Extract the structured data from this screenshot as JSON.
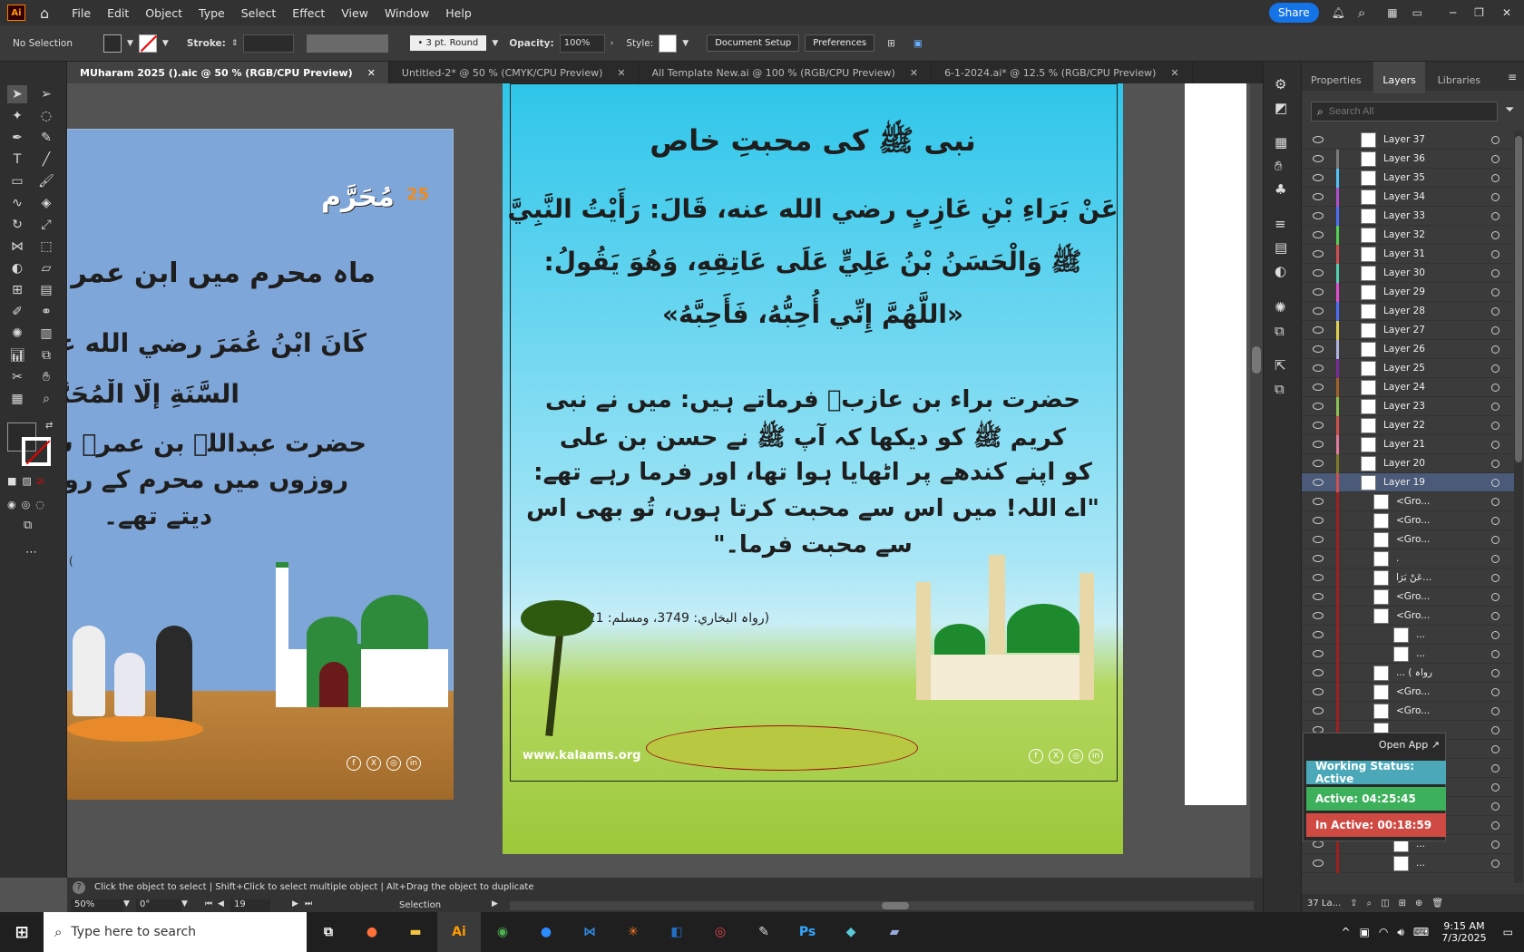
{
  "app": {
    "logo": "Ai",
    "menu": [
      "File",
      "Edit",
      "Object",
      "Type",
      "Select",
      "Effect",
      "View",
      "Window",
      "Help"
    ],
    "share": "Share"
  },
  "control": {
    "selection": "No Selection",
    "stroke_label": "Stroke:",
    "brush": "3 pt. Round",
    "opacity_label": "Opacity:",
    "opacity": "100%",
    "style_label": "Style:",
    "doc_setup": "Document Setup",
    "preferences": "Preferences"
  },
  "tabs": [
    {
      "label": "MUharam 2025 ().aic @ 50 % (RGB/CPU Preview)"
    },
    {
      "label": "Untitled-2* @ 50 % (CMYK/CPU Preview)"
    },
    {
      "label": "All Template New.ai @ 100 % (RGB/CPU Preview)"
    },
    {
      "label": "6-1-2024.ai* @ 12.5 % (RGB/CPU Preview)"
    }
  ],
  "left_art": {
    "logo_text": "مُحَرَّم",
    "logo_num": "25",
    "headline": "ماہ محرم میں ابن عمر",
    "arabic1": "كَانَ ابْنُ عُمَرَ رضي الله عنهما",
    "arabic2": "السَّنَةِ إِلَّا الْمُحَرَّ",
    "urdu1": "حضرت عبداللہ بن عمرؓ سا",
    "urdu2": "روزوں میں محرم کے روز",
    "urdu3": "دیتے تھے۔",
    "paren": "(",
    "social": [
      "f",
      "X",
      "◎",
      "in"
    ]
  },
  "main_art": {
    "title": "نبی ﷺ کی محبتِ خاص",
    "arabic": [
      "عَنْ بَرَاءِ بْنِ عَازِبٍ رضي الله عنه، قَالَ: رَأَيْتُ النَّبِيَّ",
      "ﷺ وَالْحَسَنُ بْنُ عَلِيٍّ عَلَى عَاتِقِهِ، وَهُوَ يَقُولُ:",
      "«اللَّهُمَّ إِنِّي أُحِبُّهُ، فَأَحِبَّهُ»"
    ],
    "urdu": [
      "حضرت براء بن عازبؓ فرماتے ہیں: میں نے نبی",
      "کریم ﷺ کو دیکھا کہ آپ ﷺ نے حسن بن علی",
      "کو اپنے کندھے پر اٹھایا ہوا تھا، اور فرما رہے تھے:",
      "\"اے اللہ! میں اس سے محبت کرتا ہوں، تُو بھی اس",
      "سے محبت فرما۔\""
    ],
    "reference": "(رواہ البخاري: 3749، ومسلم: 2421 )",
    "website": "www.kalaams.org",
    "social": [
      "f",
      "X",
      "◎",
      "in"
    ]
  },
  "status": {
    "hint": "Click the object to select  |  Shift+Click to select multiple object  |  Alt+Drag the object to duplicate",
    "zoom": "50%",
    "rotation": "0°",
    "artboard": "19",
    "tool": "Selection"
  },
  "panel": {
    "tabs": [
      "Properties",
      "Layers",
      "Libraries"
    ],
    "search_placeholder": "Search All",
    "layers": [
      {
        "name": "Layer 37",
        "color": "#3c3c3c"
      },
      {
        "name": "Layer 36",
        "color": "#7a7a7a"
      },
      {
        "name": "Layer 35",
        "color": "#4fc3f7"
      },
      {
        "name": "Layer 34",
        "color": "#b04fd0"
      },
      {
        "name": "Layer 33",
        "color": "#4f6ef7"
      },
      {
        "name": "Layer 32",
        "color": "#4fd04f"
      },
      {
        "name": "Layer 31",
        "color": "#d04f4f"
      },
      {
        "name": "Layer 30",
        "color": "#4fd0b0"
      },
      {
        "name": "Layer 29",
        "color": "#e04fd0"
      },
      {
        "name": "Layer 28",
        "color": "#4f6ef7"
      },
      {
        "name": "Layer 27",
        "color": "#e0d04f"
      },
      {
        "name": "Layer 26",
        "color": "#b0b0e0"
      },
      {
        "name": "Layer 25",
        "color": "#7a2a9a"
      },
      {
        "name": "Layer 24",
        "color": "#a0602a"
      },
      {
        "name": "Layer 23",
        "color": "#8ac04f"
      },
      {
        "name": "Layer 22",
        "color": "#d04f4f"
      },
      {
        "name": "Layer 21",
        "color": "#e07a9a"
      },
      {
        "name": "Layer 20",
        "color": "#7a7a2a"
      },
      {
        "name": "Layer 19",
        "color": "#d04f4f",
        "selected": true
      },
      {
        "name": "<Gro...",
        "color": "#a01f1f",
        "sub": true
      },
      {
        "name": "<Gro...",
        "color": "#a01f1f",
        "sub": true
      },
      {
        "name": "<Gro...",
        "color": "#a01f1f",
        "sub": true
      },
      {
        "name": ".",
        "color": "#a01f1f",
        "sub": true
      },
      {
        "name": "عَنْ بَرَا...",
        "color": "#a01f1f",
        "sub": true
      },
      {
        "name": "<Gro...",
        "color": "#a01f1f",
        "sub": true
      },
      {
        "name": "<Gro...",
        "color": "#a01f1f",
        "sub": true
      },
      {
        "name": "...",
        "color": "#a01f1f",
        "sub": true,
        "deep": true
      },
      {
        "name": "...",
        "color": "#a01f1f",
        "sub": true,
        "deep": true
      },
      {
        "name": "... ( رواہ",
        "color": "#a01f1f",
        "sub": true
      },
      {
        "name": "<Gro...",
        "color": "#a01f1f",
        "sub": true
      },
      {
        "name": "<Gro...",
        "color": "#a01f1f",
        "sub": true
      },
      {
        "name": "",
        "color": "#a01f1f",
        "sub": true
      },
      {
        "name": "",
        "color": "#a01f1f",
        "sub": true
      },
      {
        "name": "",
        "color": "#a01f1f",
        "sub": true
      },
      {
        "name": "",
        "color": "#a01f1f",
        "sub": true
      },
      {
        "name": "",
        "color": "#a01f1f",
        "sub": true
      },
      {
        "name": "...",
        "color": "#a01f1f",
        "sub": true,
        "deep": true
      },
      {
        "name": "...",
        "color": "#a01f1f",
        "sub": true,
        "deep": true
      },
      {
        "name": "...",
        "color": "#a01f1f",
        "sub": true,
        "deep": true
      }
    ],
    "footer": "37 La..."
  },
  "work_widget": {
    "open_app": "Open App",
    "working": "Working Status: Active",
    "active": "Active: 04:25:45",
    "inactive": "In Active: 00:18:59"
  },
  "taskbar": {
    "search_placeholder": "Type here to search",
    "time": "9:15 AM",
    "date": "7/3/2025"
  }
}
